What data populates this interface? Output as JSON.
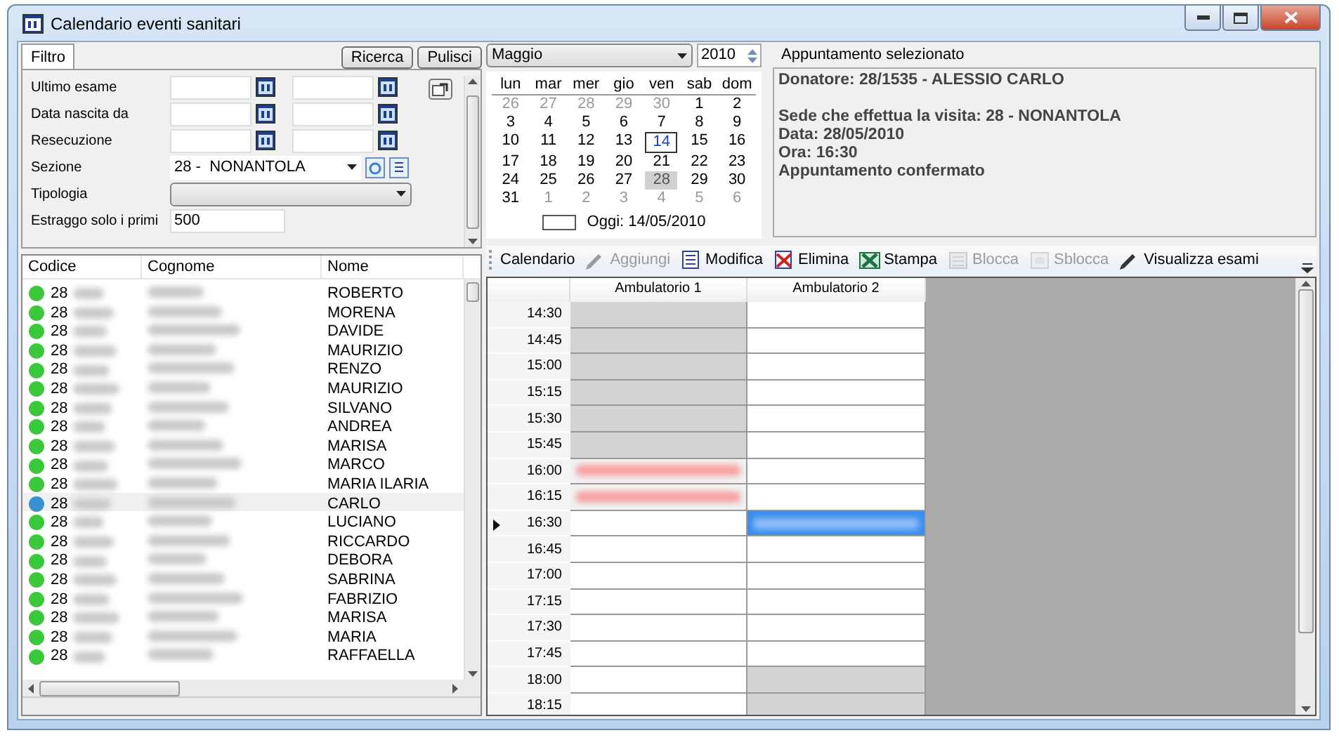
{
  "window": {
    "title": "Calendario eventi sanitari"
  },
  "filter": {
    "tabs": [
      {
        "label": "Filtro",
        "selected": true
      }
    ],
    "buttons": [
      "Ricerca",
      "Pulisci"
    ],
    "fields": [
      {
        "kind": "date_range",
        "label": "Ultimo esame"
      },
      {
        "kind": "date_range",
        "label": "Data nascita da"
      },
      {
        "kind": "date_range",
        "label": "Resecuzione"
      },
      {
        "kind": "combo_actions",
        "label": "Sezione",
        "value": "28 -  NONANTOLA"
      },
      {
        "kind": "combo",
        "label": "Tipologia"
      },
      {
        "kind": "text",
        "label": "Estraggo solo i primi",
        "value": "500"
      }
    ]
  },
  "calendar": {
    "month": "Maggio",
    "year": "2010",
    "weekdays": [
      "lun",
      "mar",
      "mer",
      "gio",
      "ven",
      "sab",
      "dom"
    ],
    "days": [
      {
        "d": "26",
        "other": true,
        "today": false,
        "selected": false
      },
      {
        "d": "27",
        "other": true,
        "today": false,
        "selected": false
      },
      {
        "d": "28",
        "other": true,
        "today": false,
        "selected": false
      },
      {
        "d": "29",
        "other": true,
        "today": false,
        "selected": false
      },
      {
        "d": "30",
        "other": true,
        "today": false,
        "selected": false
      },
      {
        "d": "1",
        "other": false,
        "today": false,
        "selected": false
      },
      {
        "d": "2",
        "other": false,
        "today": false,
        "selected": false
      },
      {
        "d": "3",
        "other": false,
        "today": false,
        "selected": false
      },
      {
        "d": "4",
        "other": false,
        "today": false,
        "selected": false
      },
      {
        "d": "5",
        "other": false,
        "today": false,
        "selected": false
      },
      {
        "d": "6",
        "other": false,
        "today": false,
        "selected": false
      },
      {
        "d": "7",
        "other": false,
        "today": false,
        "selected": false
      },
      {
        "d": "8",
        "other": false,
        "today": false,
        "selected": false
      },
      {
        "d": "9",
        "other": false,
        "today": false,
        "selected": false
      },
      {
        "d": "10",
        "other": false,
        "today": false,
        "selected": false
      },
      {
        "d": "11",
        "other": false,
        "today": false,
        "selected": false
      },
      {
        "d": "12",
        "other": false,
        "today": false,
        "selected": false
      },
      {
        "d": "13",
        "other": false,
        "today": false,
        "selected": false
      },
      {
        "d": "14",
        "other": false,
        "today": true,
        "selected": false
      },
      {
        "d": "15",
        "other": false,
        "today": false,
        "selected": false
      },
      {
        "d": "16",
        "other": false,
        "today": false,
        "selected": false
      },
      {
        "d": "17",
        "other": false,
        "today": false,
        "selected": false
      },
      {
        "d": "18",
        "other": false,
        "today": false,
        "selected": false
      },
      {
        "d": "19",
        "other": false,
        "today": false,
        "selected": false
      },
      {
        "d": "20",
        "other": false,
        "today": false,
        "selected": false
      },
      {
        "d": "21",
        "other": false,
        "today": false,
        "selected": false
      },
      {
        "d": "22",
        "other": false,
        "today": false,
        "selected": false
      },
      {
        "d": "23",
        "other": false,
        "today": false,
        "selected": false
      },
      {
        "d": "24",
        "other": false,
        "today": false,
        "selected": false
      },
      {
        "d": "25",
        "other": false,
        "today": false,
        "selected": false
      },
      {
        "d": "26",
        "other": false,
        "today": false,
        "selected": false
      },
      {
        "d": "27",
        "other": false,
        "today": false,
        "selected": false
      },
      {
        "d": "28",
        "other": false,
        "today": false,
        "selected": true
      },
      {
        "d": "29",
        "other": false,
        "today": false,
        "selected": false
      },
      {
        "d": "30",
        "other": false,
        "today": false,
        "selected": false
      },
      {
        "d": "31",
        "other": false,
        "today": false,
        "selected": false
      },
      {
        "d": "1",
        "other": true,
        "today": false,
        "selected": false
      },
      {
        "d": "2",
        "other": true,
        "today": false,
        "selected": false
      },
      {
        "d": "3",
        "other": true,
        "today": false,
        "selected": false
      },
      {
        "d": "4",
        "other": true,
        "today": false,
        "selected": false
      },
      {
        "d": "5",
        "other": true,
        "today": false,
        "selected": false
      },
      {
        "d": "6",
        "other": true,
        "today": false,
        "selected": false
      }
    ],
    "today_label": "Oggi: 14/05/2010"
  },
  "appointment": {
    "title": "Appuntamento selezionato",
    "paragraphs": [
      [
        "Donatore: 28/1535 - ALESSIO CARLO"
      ],
      [
        "Sede che effettua la visita: 28 - NONANTOLA",
        "Data: 28/05/2010",
        "Ora: 16:30",
        "Appuntamento confermato"
      ]
    ]
  },
  "patients": {
    "columns": [
      "Codice",
      "Cognome",
      "Nome"
    ],
    "rows": [
      {
        "code": "28",
        "name": "ROBERTO",
        "color": "#3cc83c",
        "selected": false
      },
      {
        "code": "28",
        "name": "MORENA",
        "color": "#3cc83c",
        "selected": false
      },
      {
        "code": "28",
        "name": "DAVIDE",
        "color": "#3cc83c",
        "selected": false
      },
      {
        "code": "28",
        "name": "MAURIZIO",
        "color": "#3cc83c",
        "selected": false
      },
      {
        "code": "28",
        "name": "RENZO",
        "color": "#3cc83c",
        "selected": false
      },
      {
        "code": "28",
        "name": "MAURIZIO",
        "color": "#3cc83c",
        "selected": false
      },
      {
        "code": "28",
        "name": "SILVANO",
        "color": "#3cc83c",
        "selected": false
      },
      {
        "code": "28",
        "name": "ANDREA",
        "color": "#3cc83c",
        "selected": false
      },
      {
        "code": "28",
        "name": "MARISA",
        "color": "#3cc83c",
        "selected": false
      },
      {
        "code": "28",
        "name": "MARCO",
        "color": "#3cc83c",
        "selected": false
      },
      {
        "code": "28",
        "name": "MARIA ILARIA",
        "color": "#3cc83c",
        "selected": false
      },
      {
        "code": "28",
        "name": "CARLO",
        "color": "#3a8fd0",
        "selected": true
      },
      {
        "code": "28",
        "name": "LUCIANO",
        "color": "#3cc83c",
        "selected": false
      },
      {
        "code": "28",
        "name": "RICCARDO",
        "color": "#3cc83c",
        "selected": false
      },
      {
        "code": "28",
        "name": "DEBORA",
        "color": "#3cc83c",
        "selected": false
      },
      {
        "code": "28",
        "name": "SABRINA",
        "color": "#3cc83c",
        "selected": false
      },
      {
        "code": "28",
        "name": "FABRIZIO",
        "color": "#3cc83c",
        "selected": false
      },
      {
        "code": "28",
        "name": "MARISA",
        "color": "#3cc83c",
        "selected": false
      },
      {
        "code": "28",
        "name": "MARIA",
        "color": "#3cc83c",
        "selected": false
      },
      {
        "code": "28",
        "name": "RAFFAELLA",
        "color": "#3cc83c",
        "selected": false
      }
    ]
  },
  "toolbar": [
    {
      "label": "Calendario",
      "disabled": false
    },
    {
      "label": "Aggiungi",
      "disabled": true
    },
    {
      "label": "Modifica",
      "disabled": false
    },
    {
      "label": "Elimina",
      "disabled": false
    },
    {
      "label": "Stampa",
      "disabled": false
    },
    {
      "label": "Blocca",
      "disabled": true
    },
    {
      "label": "Sblocca",
      "disabled": true
    },
    {
      "label": "Visualizza esami",
      "disabled": false
    }
  ],
  "schedule": {
    "columns": [
      "Ambulatorio 1",
      "Ambulatorio 2"
    ],
    "rows": [
      {
        "time": "14:30",
        "current": false,
        "cells": [
          {
            "kind": "blocked",
            "selected": false
          },
          {
            "kind": "free",
            "selected": false
          }
        ]
      },
      {
        "time": "14:45",
        "current": false,
        "cells": [
          {
            "kind": "blocked",
            "selected": false
          },
          {
            "kind": "free",
            "selected": false
          }
        ]
      },
      {
        "time": "15:00",
        "current": false,
        "cells": [
          {
            "kind": "blocked",
            "selected": false
          },
          {
            "kind": "free",
            "selected": false
          }
        ]
      },
      {
        "time": "15:15",
        "current": false,
        "cells": [
          {
            "kind": "blocked",
            "selected": false
          },
          {
            "kind": "free",
            "selected": false
          }
        ]
      },
      {
        "time": "15:30",
        "current": false,
        "cells": [
          {
            "kind": "blocked",
            "selected": false
          },
          {
            "kind": "free",
            "selected": false
          }
        ]
      },
      {
        "time": "15:45",
        "current": false,
        "cells": [
          {
            "kind": "blocked",
            "selected": false
          },
          {
            "kind": "free",
            "selected": false
          }
        ]
      },
      {
        "time": "16:00",
        "current": false,
        "cells": [
          {
            "kind": "booked",
            "selected": false
          },
          {
            "kind": "free",
            "selected": false
          }
        ]
      },
      {
        "time": "16:15",
        "current": false,
        "cells": [
          {
            "kind": "booked",
            "selected": false
          },
          {
            "kind": "free",
            "selected": false
          }
        ]
      },
      {
        "time": "16:30",
        "current": true,
        "cells": [
          {
            "kind": "free",
            "selected": false
          },
          {
            "kind": "booked",
            "selected": true
          }
        ]
      },
      {
        "time": "16:45",
        "current": false,
        "cells": [
          {
            "kind": "free",
            "selected": false
          },
          {
            "kind": "free",
            "selected": false
          }
        ]
      },
      {
        "time": "17:00",
        "current": false,
        "cells": [
          {
            "kind": "free",
            "selected": false
          },
          {
            "kind": "free",
            "selected": false
          }
        ]
      },
      {
        "time": "17:15",
        "current": false,
        "cells": [
          {
            "kind": "free",
            "selected": false
          },
          {
            "kind": "free",
            "selected": false
          }
        ]
      },
      {
        "time": "17:30",
        "current": false,
        "cells": [
          {
            "kind": "free",
            "selected": false
          },
          {
            "kind": "free",
            "selected": false
          }
        ]
      },
      {
        "time": "17:45",
        "current": false,
        "cells": [
          {
            "kind": "free",
            "selected": false
          },
          {
            "kind": "free",
            "selected": false
          }
        ]
      },
      {
        "time": "18:00",
        "current": false,
        "cells": [
          {
            "kind": "free",
            "selected": false
          },
          {
            "kind": "blocked",
            "selected": false
          }
        ]
      },
      {
        "time": "18:15",
        "current": false,
        "cells": [
          {
            "kind": "free",
            "selected": false
          },
          {
            "kind": "blocked",
            "selected": false
          }
        ]
      }
    ]
  }
}
